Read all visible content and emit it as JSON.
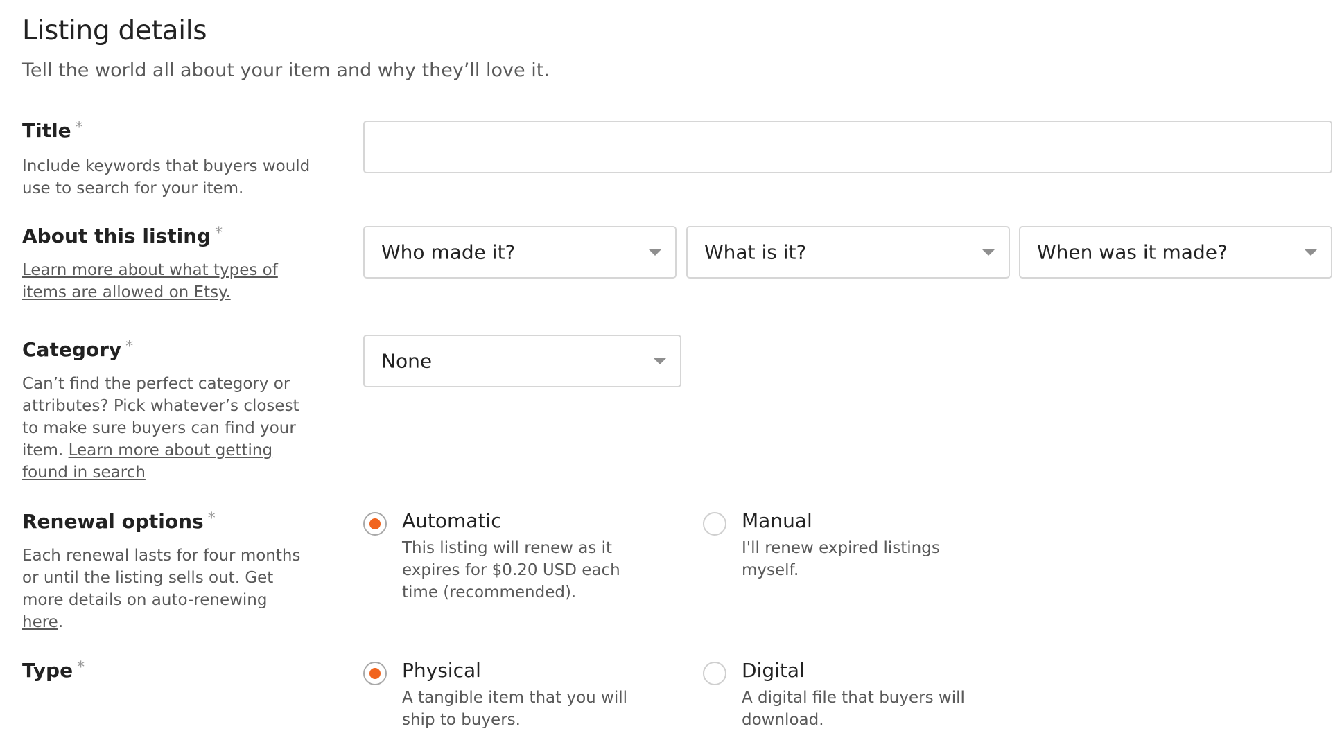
{
  "header": {
    "title": "Listing details",
    "subtitle": "Tell the world all about your item and why they’ll love it."
  },
  "required_marker": "*",
  "title_field": {
    "label": "Title",
    "help": "Include keywords that buyers would use to search for your item.",
    "value": ""
  },
  "about": {
    "label": "About this listing",
    "help_link": "Learn more about what types of items are allowed on Etsy.",
    "who_made": "Who made it?",
    "what_is": "What is it?",
    "when_made": "When was it made?"
  },
  "category": {
    "label": "Category",
    "help": "Can’t find the perfect category or attributes? Pick whatever’s closest to make sure buyers can find your item.",
    "help_link": "Learn more about getting found in search",
    "value": "None"
  },
  "renewal": {
    "label": "Renewal options",
    "help": "Each renewal lasts for four months or until the listing sells out. Get more details on auto-renewing",
    "help_link": "here",
    "help_end": ".",
    "options": [
      {
        "label": "Automatic",
        "desc": "This listing will renew as it expires for $0.20 USD each time (recommended).",
        "selected": true
      },
      {
        "label": "Manual",
        "desc": "I'll renew expired listings myself.",
        "selected": false
      }
    ]
  },
  "type": {
    "label": "Type",
    "options": [
      {
        "label": "Physical",
        "desc": "A tangible item that you will ship to buyers.",
        "selected": true
      },
      {
        "label": "Digital",
        "desc": "A digital file that buyers will download.",
        "selected": false
      }
    ]
  },
  "colors": {
    "accent": "#f1641e",
    "text": "#222222",
    "muted": "#595959",
    "border": "#d6d6d6"
  }
}
